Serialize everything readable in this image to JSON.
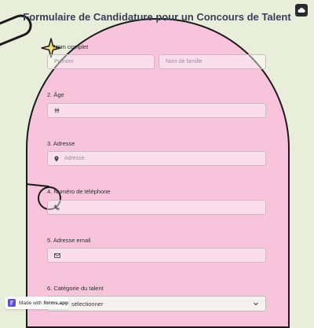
{
  "form": {
    "title": "Formulaire de Candidature pour un Concours de Talent",
    "fields": [
      {
        "label": "Nom complet",
        "first_placeholder": "Prénom",
        "last_placeholder": "Nom de famille"
      },
      {
        "label": "2. Âge",
        "icon": "hash-icon"
      },
      {
        "label": "3. Adresse",
        "placeholder": "Adresse",
        "icon": "location-pin-icon"
      },
      {
        "label": "4. Numéro de téléphone",
        "icon": "phone-icon"
      },
      {
        "label": "5. Adresse email",
        "icon": "envelope-icon"
      },
      {
        "label": "6. Catégorie du talent",
        "select_value": "sélectionner"
      }
    ]
  },
  "badge": {
    "prefix": "Made with",
    "brand": "forms.app"
  },
  "colors": {
    "background": "#e9eedb",
    "arch": "#f7c4dc",
    "title": "#3a3f55",
    "star": "#f3e27a"
  }
}
